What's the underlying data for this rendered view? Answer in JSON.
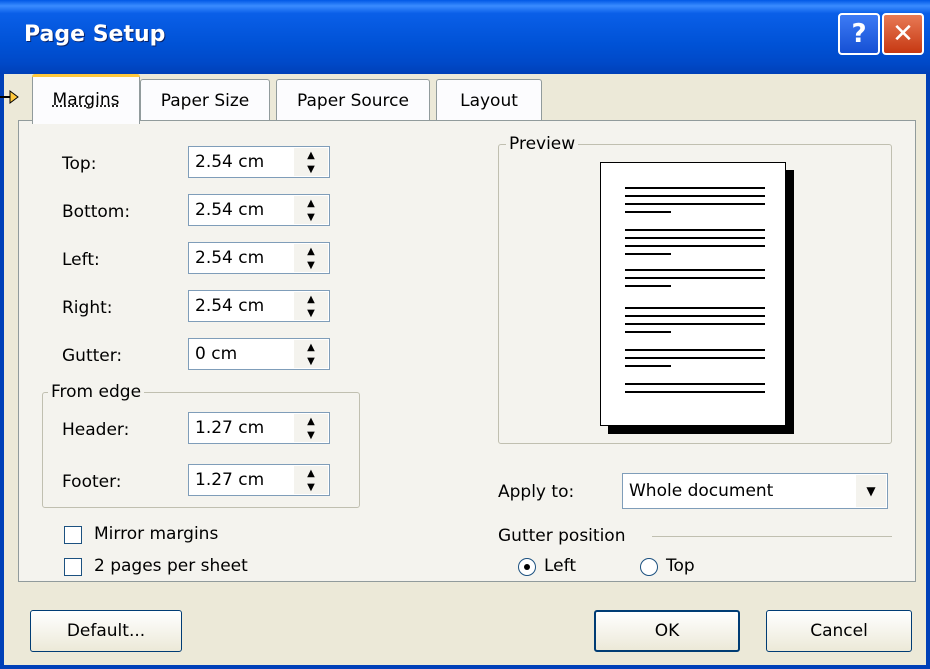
{
  "window": {
    "title": "Page Setup",
    "help_glyph": "?",
    "close_glyph": "✕"
  },
  "tabs": [
    {
      "label": "Margins",
      "active": true
    },
    {
      "label": "Paper Size",
      "active": false
    },
    {
      "label": "Paper Source",
      "active": false
    },
    {
      "label": "Layout",
      "active": false
    }
  ],
  "margins": {
    "top": {
      "label": "Top:",
      "value": "2.54 cm"
    },
    "bottom": {
      "label": "Bottom:",
      "value": "2.54 cm"
    },
    "left": {
      "label": "Left:",
      "value": "2.54 cm"
    },
    "right": {
      "label": "Right:",
      "value": "2.54 cm"
    },
    "gutter": {
      "label": "Gutter:",
      "value": "0 cm"
    }
  },
  "from_edge": {
    "legend": "From edge",
    "header": {
      "label": "Header:",
      "value": "1.27 cm"
    },
    "footer": {
      "label": "Footer:",
      "value": "1.27 cm"
    }
  },
  "checkboxes": {
    "mirror": {
      "label": "Mirror margins",
      "checked": false
    },
    "two_pages": {
      "label": "2 pages per sheet",
      "checked": false
    }
  },
  "preview": {
    "legend": "Preview"
  },
  "apply_to": {
    "label": "Apply to:",
    "value": "Whole document"
  },
  "gutter_position": {
    "legend": "Gutter position",
    "left_label": "Left",
    "top_label": "Top",
    "selected": "Left"
  },
  "buttons": {
    "default": "Default...",
    "ok": "OK",
    "cancel": "Cancel"
  },
  "colors": {
    "titlebar": "#0054e3",
    "dialog_bg": "#ece9d8",
    "tab_highlight": "#ffc83c"
  }
}
